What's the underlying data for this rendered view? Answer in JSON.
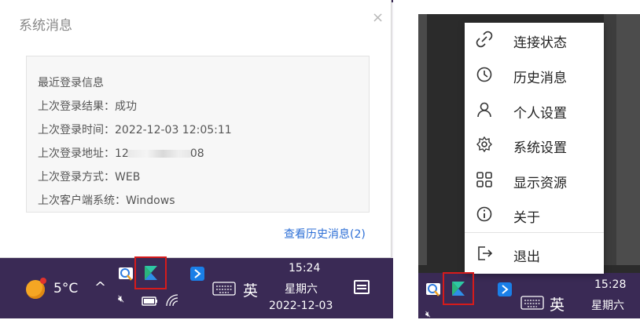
{
  "dialog": {
    "title": "系统消息",
    "close": "×",
    "info_title": "最近登录信息",
    "lines": [
      {
        "label": "上次登录结果：",
        "value": "成功"
      },
      {
        "label": "上次登录时间：",
        "value": "2022-12-03 12:05:11"
      },
      {
        "label": "上次登录地址：",
        "value_prefix": "12",
        "value_suffix": "08"
      },
      {
        "label": "上次登录方式：",
        "value": "WEB"
      },
      {
        "label": "上次客户端系统：",
        "value": "Windows"
      }
    ],
    "history_link": "查看历史消息(2)"
  },
  "taskbar_left": {
    "weather_temp": "5°C",
    "ime": "英",
    "time": "15:24",
    "weekday": "星期六",
    "date": "2022-12-03",
    "icons": [
      "sun-weather-icon",
      "chevron-up-icon",
      "quicksearch-icon",
      "app-s-icon",
      "bluetooth-icon",
      "volume-mute-icon",
      "battery-icon",
      "wifi-icon",
      "keyboard-icon",
      "notification-icon"
    ]
  },
  "menu": {
    "items": [
      {
        "label": "连接状态",
        "icon": "link-icon"
      },
      {
        "label": "历史消息",
        "icon": "clock-icon"
      },
      {
        "label": "个人设置",
        "icon": "user-icon"
      },
      {
        "label": "系统设置",
        "icon": "gear-icon"
      },
      {
        "label": "显示资源",
        "icon": "grid-icon"
      },
      {
        "label": "关于",
        "icon": "info-icon"
      },
      {
        "label": "退出",
        "icon": "logout-icon"
      }
    ]
  },
  "taskbar_right": {
    "ime": "英",
    "time": "15:28",
    "weekday": "星期六"
  },
  "colors": {
    "taskbar": "#3a2a55",
    "link": "#2d6fd6",
    "highlight": "#d61b1b"
  }
}
